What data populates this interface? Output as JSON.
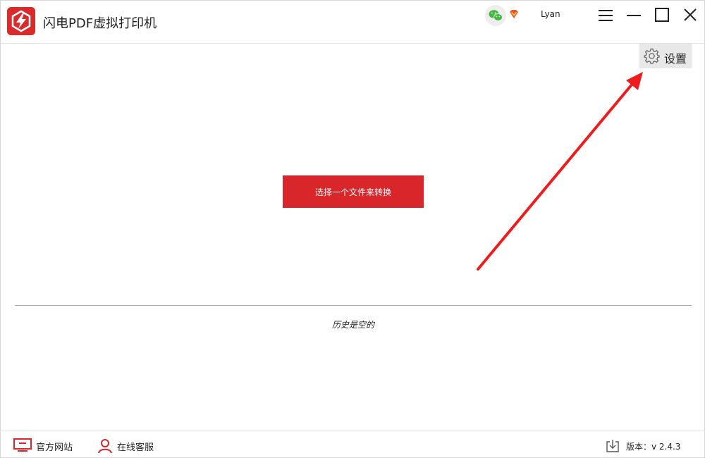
{
  "app": {
    "title": "闪电PDF虚拟打印机"
  },
  "user": {
    "name": "Lyan"
  },
  "settings": {
    "label": "设置"
  },
  "main": {
    "convert_button": "选择一个文件来转换",
    "history_empty": "历史是空的"
  },
  "footer": {
    "website": "官方网站",
    "support": "在线客服",
    "version": "版本：v 2.4.3"
  },
  "colors": {
    "brand_red": "#d9262a",
    "arrow_red": "#ee1c1c",
    "wechat_green": "#3eb93b"
  },
  "icons": [
    "app-logo-icon",
    "wechat-icon",
    "vip-icon",
    "menu-icon",
    "minimize-icon",
    "maximize-icon",
    "close-icon",
    "gear-icon",
    "monitor-icon",
    "user-icon",
    "download-icon"
  ]
}
